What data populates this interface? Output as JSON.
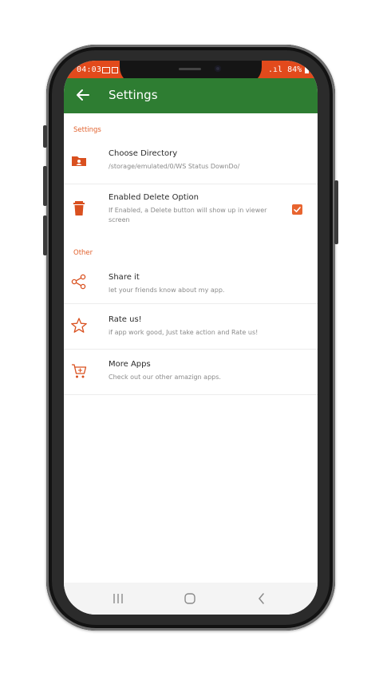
{
  "status_bar": {
    "time": "04:03",
    "right_text": " .ıl 84%"
  },
  "app_bar": {
    "title": "Settings",
    "back_icon": "arrow-left-icon"
  },
  "sections": {
    "settings_header": "Settings",
    "other_header": "Other"
  },
  "items": {
    "choose_directory": {
      "title": "Choose Directory",
      "subtitle": "/storage/emulated/0/WS Status DownDo/",
      "icon": "folder-user-icon"
    },
    "delete_option": {
      "title": "Enabled Delete Option",
      "subtitle": "If Enabled, a Delete button will show up in viewer screen",
      "icon": "trash-icon",
      "checked": true
    },
    "share": {
      "title": "Share it",
      "subtitle": "let your friends know about my app.",
      "icon": "share-icon"
    },
    "rate": {
      "title": "Rate us!",
      "subtitle": "if app work good, Just take action and Rate us!",
      "icon": "star-icon"
    },
    "more_apps": {
      "title": "More Apps",
      "subtitle": "Check out our other amazign apps.",
      "icon": "cart-icon"
    }
  },
  "colors": {
    "app_bar": "#2e7d32",
    "status_bar": "#e24a1c",
    "accent": "#e2622e"
  }
}
